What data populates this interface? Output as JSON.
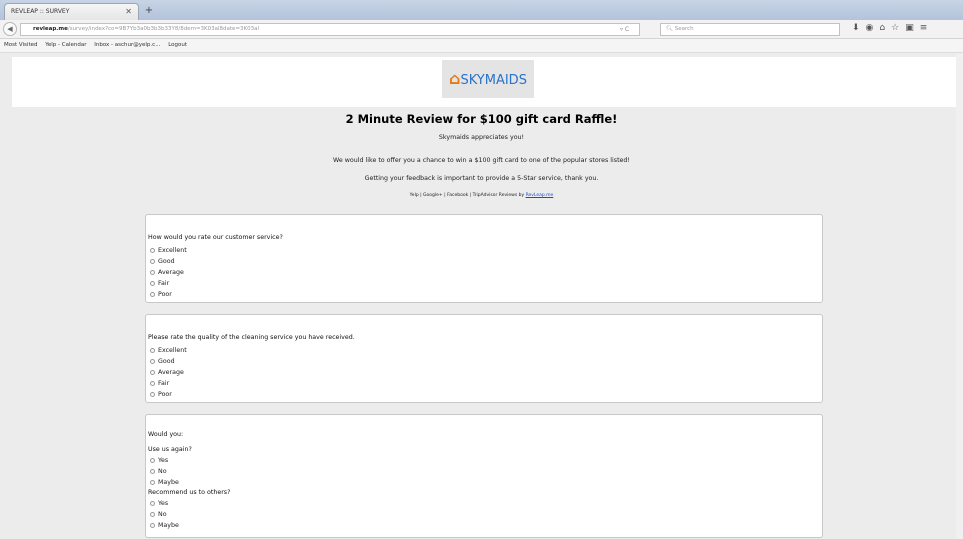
{
  "browser": {
    "tab_title": "REVLEAP :: SURVEY",
    "new_tab": "+",
    "url_host": "revleap.me",
    "url_path": "/survey/index?co=9B7Yb3a0b3b3b33Y8/8dem=3K03al8date=3K03al",
    "search_placeholder": "Search",
    "bookmarks": [
      "Most Visited",
      "Yelp - Calendar",
      "Inbox - aschur@yelp.c...",
      "Logout"
    ]
  },
  "page": {
    "logo_text": "SKYMAIDS",
    "title": "2 Minute Review for $100 gift card Raffle!",
    "line1": "Skymaids appreciates you!",
    "line2": "We would like to offer you a chance to win a $100 gift card to one of the popular stores listed!",
    "line3": "Getting your feedback is important to provide a 5-Star service, thank you.",
    "links_prefix": "Yelp | Google+ | Facebook | TripAdvisor Reviews by",
    "links_brand": "RevLeap.me"
  },
  "questions": {
    "q1": {
      "text": "How would you rate our customer service?",
      "options": [
        "Excellent",
        "Good",
        "Average",
        "Fair",
        "Poor"
      ]
    },
    "q2": {
      "text": "Please rate the quality of the cleaning service you have received.",
      "options": [
        "Excellent",
        "Good",
        "Average",
        "Fair",
        "Poor"
      ]
    },
    "q3": {
      "text": "Would you:",
      "sub1": "Use us again?",
      "sub1_options": [
        "Yes",
        "No",
        "Maybe"
      ],
      "sub2": "Recommend us to others?",
      "sub2_options": [
        "Yes",
        "No",
        "Maybe"
      ]
    }
  }
}
